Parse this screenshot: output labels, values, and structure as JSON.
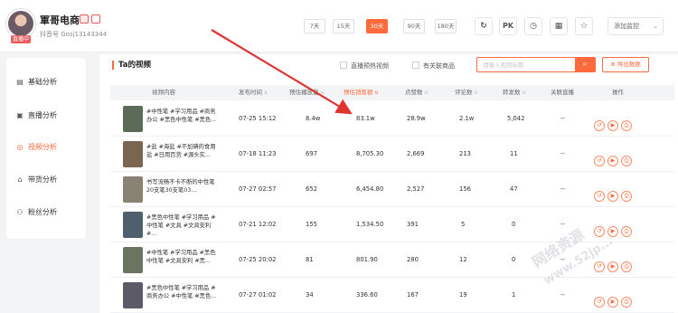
{
  "account": {
    "name": "軍哥电商",
    "live_badge": "直播中",
    "id_text": "抖音号 Gosj13143344"
  },
  "day_filters": [
    {
      "label": "7天",
      "active": false
    },
    {
      "label": "15天",
      "active": false
    },
    {
      "label": "30天",
      "active": true
    },
    {
      "label": "90天",
      "active": false
    },
    {
      "label": "180天",
      "active": false
    }
  ],
  "header_actions": {
    "refresh_icon": "↻",
    "pk_label": "PK",
    "history_icon": "◷",
    "qr_icon": "▦",
    "star_icon": "☆",
    "monitor_label": "添加监控",
    "monitor_chevron": "⌄"
  },
  "sidebar": {
    "items": [
      {
        "label": "基础分析",
        "icon": "document-icon",
        "glyph": "▤",
        "active": false
      },
      {
        "label": "直播分析",
        "icon": "live-icon",
        "glyph": "▣",
        "active": false
      },
      {
        "label": "视频分析",
        "icon": "video-icon",
        "glyph": "◎",
        "active": true
      },
      {
        "label": "带货分析",
        "icon": "bag-icon",
        "glyph": "⌂",
        "active": false
      },
      {
        "label": "粉丝分析",
        "icon": "user-icon",
        "glyph": "⚇",
        "active": false
      }
    ]
  },
  "main": {
    "section_title": "Ta的视频",
    "filter_preheat": "直播预热视频",
    "filter_products": "有关联商品",
    "search_placeholder": "请输入视频标题",
    "search_icon": "⌕",
    "export_label": "导出数据",
    "export_icon": "⊕"
  },
  "table": {
    "columns": [
      {
        "label": "视频内容",
        "sort": "",
        "highlight": false
      },
      {
        "label": "发布时间",
        "sort": "⇅",
        "highlight": false
      },
      {
        "label": "预估播放量",
        "sort": "⇅",
        "highlight": false
      },
      {
        "label": "预估销售额",
        "sort": "⇅",
        "highlight": true
      },
      {
        "label": "点赞数",
        "sort": "⇅",
        "highlight": false
      },
      {
        "label": "评论数",
        "sort": "⇅",
        "highlight": false
      },
      {
        "label": "转发数",
        "sort": "⇅",
        "highlight": false
      },
      {
        "label": "关联直播",
        "sort": "",
        "highlight": false
      },
      {
        "label": "操作",
        "sort": "",
        "highlight": false
      }
    ],
    "rows": [
      {
        "title": "#中性笔 #学习用品 #商务办公 #黑色中性笔 #黑色...",
        "time": "07-25 15:12",
        "plays": "8.4w",
        "sales": "83.1w",
        "likes": "28.9w",
        "comments": "2.1w",
        "shares": "5,042",
        "live": "--",
        "thumb_color": "#5b6b57"
      },
      {
        "title": "#盐 #海盐 #不加碘的食用盐 #日用百货 #源头实...",
        "time": "07-18 11:23",
        "plays": "697",
        "sales": "8,705.30",
        "likes": "2,669",
        "comments": "213",
        "shares": "11",
        "live": "--",
        "thumb_color": "#7a6650"
      },
      {
        "title": "书写流畅不卡不断的中性笔20支笔30支笔03...",
        "time": "07-27 02:57",
        "plays": "652",
        "sales": "6,454.80",
        "likes": "2,527",
        "comments": "156",
        "shares": "47",
        "live": "--",
        "thumb_color": "#8a8272"
      },
      {
        "title": "#黑色中性笔 #学习用品 #中性笔 #文具 #文具安利 #...",
        "time": "07-21 12:02",
        "plays": "155",
        "sales": "1,534.50",
        "likes": "391",
        "comments": "5",
        "shares": "0",
        "live": "--",
        "thumb_color": "#4f5f6e"
      },
      {
        "title": "#中性笔 #学习用品 #黑色中性笔 #文具安利 #黑...",
        "time": "07-25 20:02",
        "plays": "81",
        "sales": "801.90",
        "likes": "280",
        "comments": "12",
        "shares": "0",
        "live": "--",
        "thumb_color": "#6a7460"
      },
      {
        "title": "#黑色中性笔 #学习用品 #商务办公 #中性笔 #黑色...",
        "time": "07-27 01:02",
        "plays": "34",
        "sales": "336.60",
        "likes": "167",
        "comments": "19",
        "shares": "1",
        "live": "--",
        "thumb_color": "#5c5a66"
      }
    ],
    "op_icons": [
      "↺",
      "▶",
      "⎙"
    ]
  },
  "watermark": {
    "line1": "网络资源",
    "line2": "www.52jp..."
  }
}
